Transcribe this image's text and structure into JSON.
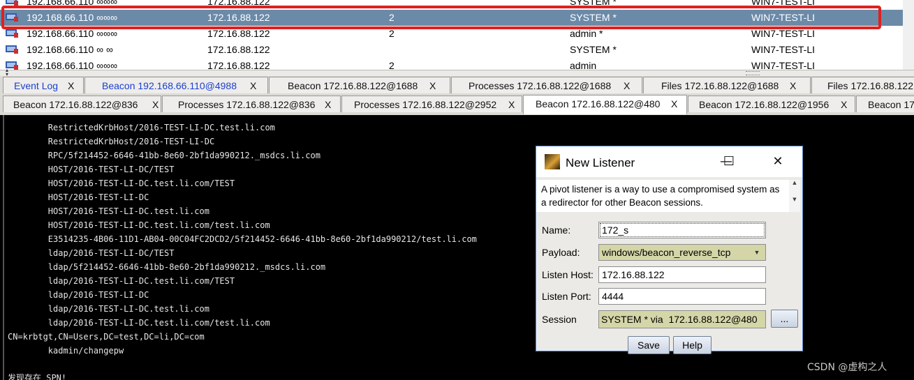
{
  "sessions": [
    {
      "external": "192.168.66.110 ∞∞∞",
      "internal": "172.16.88.122",
      "pid": "",
      "user": "SYSTEM *",
      "computer": "WIN7-TEST-LI"
    },
    {
      "external": "192.168.66.110 ∞∞∞",
      "internal": "172.16.88.122",
      "pid": "2",
      "user": "SYSTEM *",
      "computer": "WIN7-TEST-LI"
    },
    {
      "external": "192.168.66.110 ∞∞∞",
      "internal": "172.16.88.122",
      "pid": "2",
      "user": "admin *",
      "computer": "WIN7-TEST-LI"
    },
    {
      "external": "192.168.66.110 ∞ ∞",
      "internal": "172.16.88.122",
      "pid": "",
      "user": "SYSTEM *",
      "computer": "WIN7-TEST-LI"
    },
    {
      "external": "192.168.66.110 ∞∞∞",
      "internal": "172.16.88.122",
      "pid": "2",
      "user": "admin",
      "computer": "WIN7-TEST-LI"
    }
  ],
  "tabs_row1": [
    {
      "label": "Event Log",
      "close": "X"
    },
    {
      "label": "Beacon 192.168.66.110@4988",
      "close": "X"
    },
    {
      "label": "Beacon 172.16.88.122@1688",
      "close": "X"
    },
    {
      "label": "Processes 172.16.88.122@1688",
      "close": "X"
    },
    {
      "label": "Files 172.16.88.122@1688",
      "close": "X"
    },
    {
      "label": "Files 172.16.88.122",
      "close": ""
    }
  ],
  "tabs_row2": [
    {
      "label": "Beacon 172.16.88.122@836",
      "close": "X"
    },
    {
      "label": "Processes 172.16.88.122@836",
      "close": "X"
    },
    {
      "label": "Processes 172.16.88.122@2952",
      "close": "X"
    },
    {
      "label": "Beacon 172.16.88.122@480",
      "close": "X"
    },
    {
      "label": "Beacon 172.16.88.122@1956",
      "close": "X"
    },
    {
      "label": "Beacon 17",
      "close": ""
    }
  ],
  "console_lines": [
    "        RestrictedKrbHost/2016-TEST-LI-DC.test.li.com",
    "        RestrictedKrbHost/2016-TEST-LI-DC",
    "        RPC/5f214452-6646-41bb-8e60-2bf1da990212._msdcs.li.com",
    "        HOST/2016-TEST-LI-DC/TEST",
    "        HOST/2016-TEST-LI-DC.test.li.com/TEST",
    "        HOST/2016-TEST-LI-DC",
    "        HOST/2016-TEST-LI-DC.test.li.com",
    "        HOST/2016-TEST-LI-DC.test.li.com/test.li.com",
    "        E3514235-4B06-11D1-AB04-00C04FC2DCD2/5f214452-6646-41bb-8e60-2bf1da990212/test.li.com",
    "        ldap/2016-TEST-LI-DC/TEST",
    "        ldap/5f214452-6646-41bb-8e60-2bf1da990212._msdcs.li.com",
    "        ldap/2016-TEST-LI-DC.test.li.com/TEST",
    "        ldap/2016-TEST-LI-DC",
    "        ldap/2016-TEST-LI-DC.test.li.com",
    "        ldap/2016-TEST-LI-DC.test.li.com/test.li.com",
    "CN=krbtgt,CN=Users,DC=test,DC=li,DC=com",
    "        kadmin/changepw",
    "",
    "发现存在 SPN!"
  ],
  "dialog": {
    "title": "New Listener",
    "minimize": "—",
    "maximize": "☐",
    "close": "✕",
    "description": "A pivot listener is a way to use a compromised system as a redirector for other Beacon sessions.",
    "name_label": "Name:",
    "name_value": "172_s",
    "payload_label": "Payload:",
    "payload_value": "windows/beacon_reverse_tcp",
    "host_label": "Listen Host:",
    "host_value": "172.16.88.122",
    "port_label": "Listen Port:",
    "port_value": "4444",
    "session_label": "Session",
    "session_value": "SYSTEM * via  172.16.88.122@480",
    "browse_label": "...",
    "save_label": "Save",
    "help_label": "Help"
  },
  "watermark": "CSDN @虚构之人",
  "colors": {
    "highlight": "#e02020",
    "selected_row": "#6b8aa8",
    "blue_tab_text": "#1a3fd0"
  }
}
